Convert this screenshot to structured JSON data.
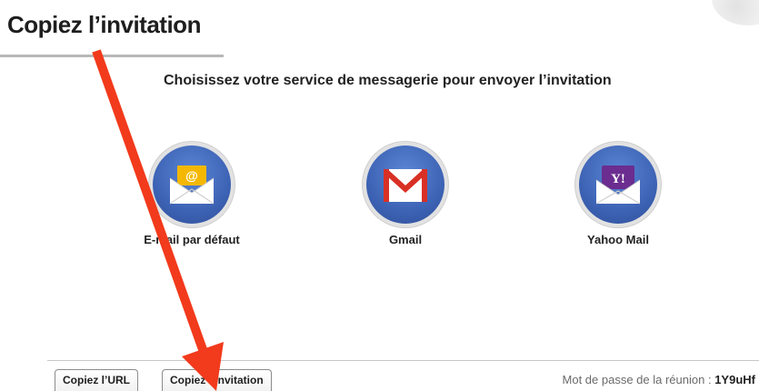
{
  "header": {
    "title": "Copiez l’invitation"
  },
  "main": {
    "subtitle": "Choisissez votre service de messagerie pour envoyer l’invitation",
    "services": [
      {
        "label": "E-mail par défaut",
        "icon": "envelope-at-icon"
      },
      {
        "label": "Gmail",
        "icon": "gmail-icon"
      },
      {
        "label": "Yahoo Mail",
        "icon": "yahoo-mail-icon"
      }
    ]
  },
  "footer": {
    "tabs": [
      {
        "label": "Copiez l’URL"
      },
      {
        "label": "Copiez l’invitation"
      }
    ],
    "password_label": "Mot de passe de la réunion :",
    "password_value": "1Y9uHf"
  },
  "annotation": {
    "arrow_color": "#f23a1c"
  },
  "colors": {
    "icon_circle": "#3d63b5",
    "envelope_yellow": "#f5b800",
    "gmail_red": "#d93025",
    "yahoo_purple": "#6b2d8f"
  }
}
